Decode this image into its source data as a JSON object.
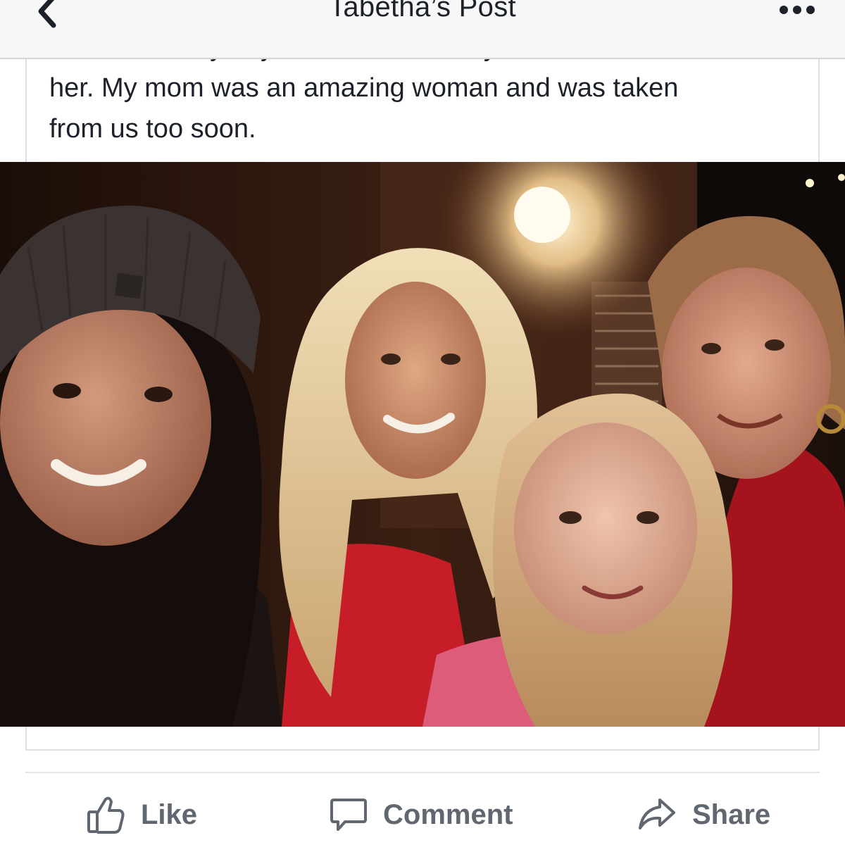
{
  "header": {
    "title": "Tabetha’s Post",
    "back_icon": "chevron-left-icon",
    "more_icon": "more-dots-icon"
  },
  "post": {
    "text_partial_line": "now and every day , for the rest of my life, I will think of",
    "text_line_1": "her. My mom was an amazing woman and was taken",
    "text_line_2": "from us too soon.",
    "photo": {
      "description_kind": "group-selfie",
      "people_count": 4
    }
  },
  "actions": {
    "like_label": "Like",
    "comment_label": "Comment",
    "share_label": "Share"
  },
  "colors": {
    "text": "#1d2129",
    "action_text": "#606770",
    "header_bg": "#f7f7f8",
    "border": "#dddfe2"
  }
}
